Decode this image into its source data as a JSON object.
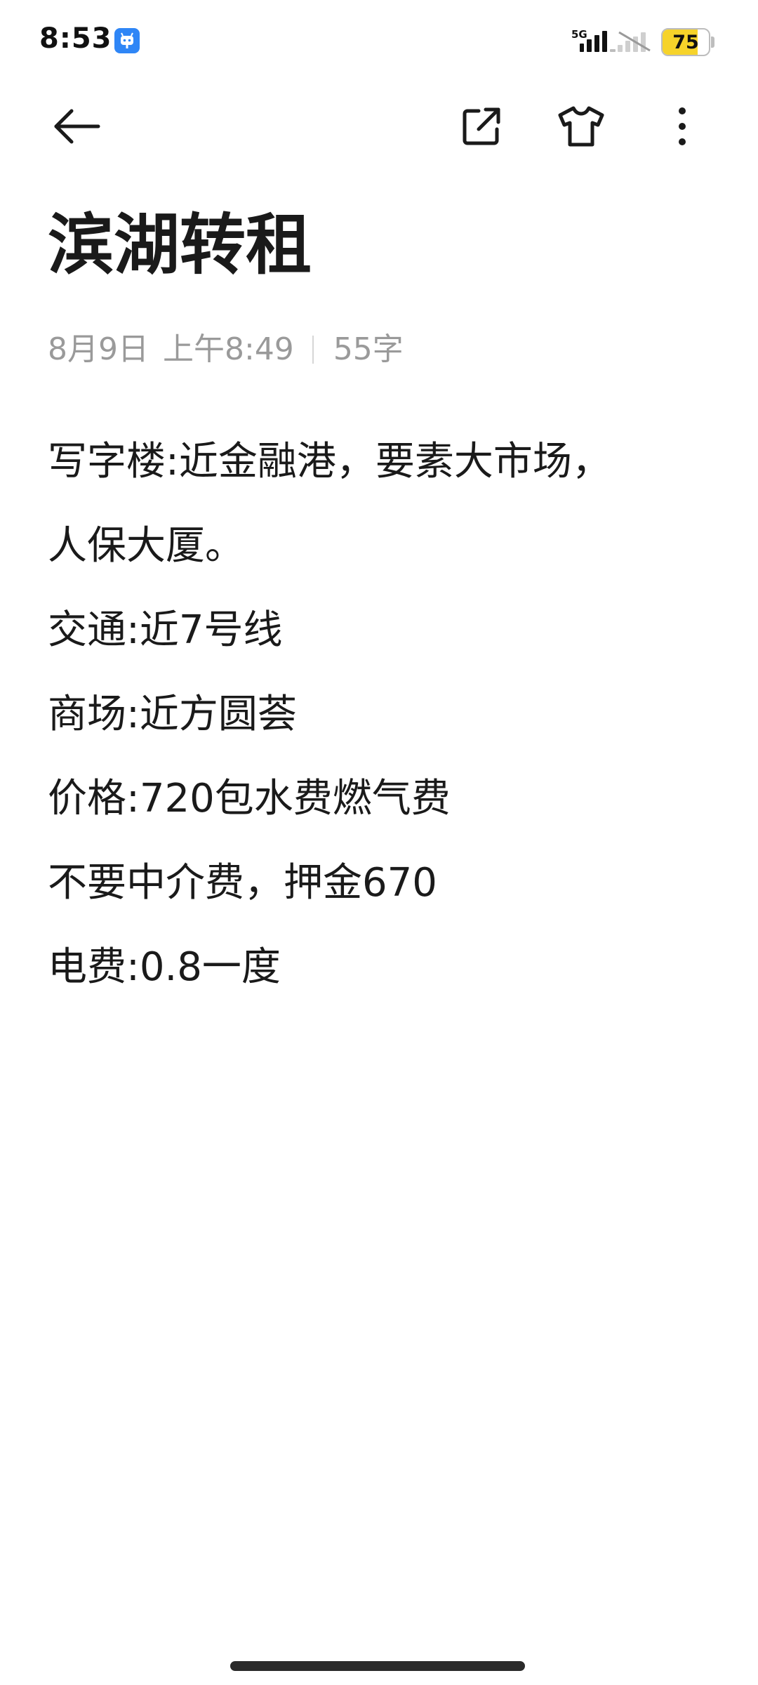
{
  "status_bar": {
    "time": "8:53",
    "network": "5G",
    "battery_level": "75",
    "battery_percent": 75,
    "battery_color": "#f6d32a"
  },
  "toolbar": {
    "back_icon": "arrow-left-icon",
    "share_icon": "share-icon",
    "theme_icon": "shirt-icon",
    "more_icon": "more-vertical-icon"
  },
  "note": {
    "title": "滨湖转租",
    "date": "8月9日",
    "time": "上午8:49",
    "word_count": "55字",
    "lines": [
      "写字楼:近金融港，要素大市场，",
      "人保大厦。",
      "交通:近7号线",
      "商场:近方圆荟",
      "价格:720包水费燃气费",
      "不要中介费，押金670",
      "电费:0.8一度"
    ]
  },
  "colors": {
    "background": "#ffffff",
    "text": "#1a1a1a",
    "meta_text": "#9a9a9a",
    "app_icon": "#2f86f6"
  }
}
